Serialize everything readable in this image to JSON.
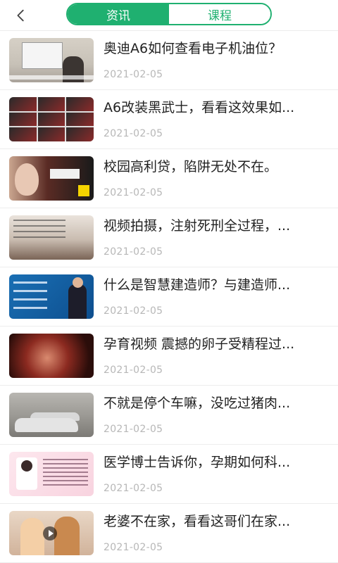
{
  "header": {
    "tabs": [
      {
        "label": "资讯",
        "active": true
      },
      {
        "label": "课程",
        "active": false
      }
    ]
  },
  "colors": {
    "accent": "#1fb070",
    "date": "#b7b7b7",
    "divider": "#ededed"
  },
  "icons": {
    "back": "chevron-left-icon",
    "play": "play-icon"
  },
  "news": [
    {
      "title": "奥迪A6如何查看电子机油位？",
      "date": "2021-02-05"
    },
    {
      "title": "A6改装黑武士，看看这效果如...",
      "date": "2021-02-05"
    },
    {
      "title": "校园高利贷，陷阱无处不在。",
      "date": "2021-02-05"
    },
    {
      "title": "视频拍摄，注射死刑全过程，...",
      "date": "2021-02-05"
    },
    {
      "title": "什么是智慧建造师？与建造师...",
      "date": "2021-02-05"
    },
    {
      "title": "孕育视频 震撼的卵子受精程过...",
      "date": "2021-02-05"
    },
    {
      "title": "不就是停个车嘛，没吃过猪肉...",
      "date": "2021-02-05"
    },
    {
      "title": "医学博士告诉你，孕期如何科...",
      "date": "2021-02-05"
    },
    {
      "title": "老婆不在家，看看这哥们在家...",
      "date": "2021-02-05"
    }
  ]
}
